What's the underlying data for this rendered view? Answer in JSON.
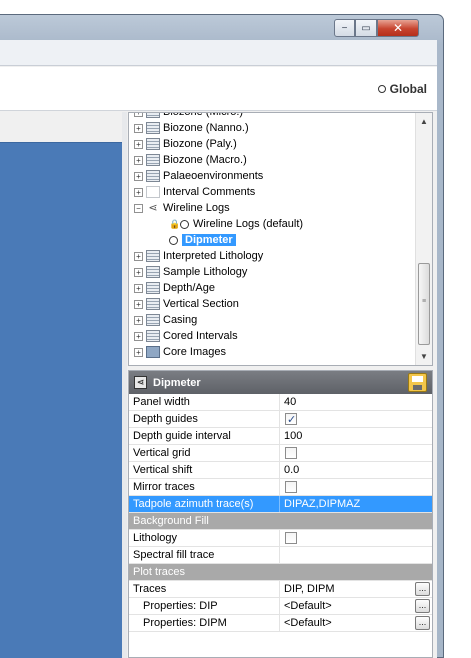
{
  "window": {
    "close_glyph": "✕",
    "restore_glyph": "▭",
    "minimize_glyph": "−"
  },
  "toolbar": {
    "global_label": "Global"
  },
  "tree": {
    "items": [
      {
        "label": "Biozone (Micro.)",
        "icon": "grid-icon"
      },
      {
        "label": "Biozone (Nanno.)",
        "icon": "grid-icon"
      },
      {
        "label": "Biozone (Paly.)",
        "icon": "grid-icon"
      },
      {
        "label": "Biozone (Macro.)",
        "icon": "grid-icon"
      },
      {
        "label": "Palaeoenvironments",
        "icon": "grid-icon"
      },
      {
        "label": "Interval Comments",
        "icon": "grid-icon"
      },
      {
        "label": "Wireline Logs",
        "icon": "wireline-icon",
        "expanded": true
      },
      {
        "label": "Wireline Logs (default)",
        "child": true,
        "locked": true
      },
      {
        "label": "Dipmeter",
        "child": true,
        "selected": true
      },
      {
        "label": "Interpreted Lithology",
        "icon": "grid-icon"
      },
      {
        "label": "Sample Lithology",
        "icon": "grid-icon"
      },
      {
        "label": "Depth/Age",
        "icon": "grid-icon"
      },
      {
        "label": "Vertical Section",
        "icon": "grid-icon"
      },
      {
        "label": "Casing",
        "icon": "grid-icon"
      },
      {
        "label": "Cored Intervals",
        "icon": "grid-icon"
      },
      {
        "label": "Core Images",
        "icon": "grid-icon"
      }
    ]
  },
  "props": {
    "title": "Dipmeter",
    "rows": [
      {
        "kind": "text",
        "name": "Panel width",
        "value": "40"
      },
      {
        "kind": "check",
        "name": "Depth guides",
        "checked": true
      },
      {
        "kind": "text",
        "name": "Depth guide interval",
        "value": "100"
      },
      {
        "kind": "check",
        "name": "Vertical grid",
        "checked": false
      },
      {
        "kind": "text",
        "name": "Vertical shift",
        "value": "0.0"
      },
      {
        "kind": "check",
        "name": "Mirror traces",
        "checked": false
      },
      {
        "kind": "text",
        "name": "Tadpole azimuth trace(s)",
        "value": "DIPAZ,DIPMAZ",
        "highlight": true
      },
      {
        "kind": "category",
        "name": "Background Fill"
      },
      {
        "kind": "check",
        "name": "Lithology",
        "checked": false
      },
      {
        "kind": "text",
        "name": "Spectral fill trace",
        "value": ""
      },
      {
        "kind": "category",
        "name": "Plot traces"
      },
      {
        "kind": "button",
        "name": "Traces",
        "value": "DIP, DIPM",
        "button_label": "..."
      },
      {
        "kind": "button",
        "name": "Properties: DIP",
        "value": "<Default>",
        "button_label": "...",
        "indent": true
      },
      {
        "kind": "button",
        "name": "Properties: DIPM",
        "value": "<Default>",
        "button_label": "...",
        "indent": true
      }
    ]
  }
}
